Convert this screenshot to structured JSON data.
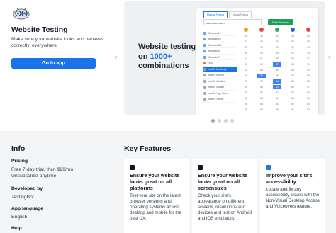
{
  "app": {
    "title": "Website Testing",
    "description": "Make sure your website looks and behaves correctly, everywhere",
    "go_button": "Go to app"
  },
  "carousel": {
    "headline_line1": "Website testing",
    "headline_on": "on ",
    "headline_count": "1000+",
    "headline_line3": "combinations",
    "prev_arrow": "‹",
    "next_arrow": "›",
    "active_slide": 1,
    "slide_count": 4,
    "mock": {
      "tabs": [
        "Manual Testing",
        "Visual Testing"
      ],
      "url": "www.ikea.com",
      "start_button": "Start Browser",
      "os_list": [
        "Windows 11",
        "Windows 10",
        "Windows 8.1",
        "Windows 8",
        "Windows 7",
        "Linux",
        "macOS Monterey",
        "macOS Big Sur",
        "macOS Catalina",
        "macOS Mojave",
        "macOS High Sierra",
        "macOS Sierra"
      ],
      "selected_os_index": 6,
      "browser_colors": [
        "#f59e0b",
        "#ea4335",
        "#34a853",
        "#2563eb",
        "#ef4444"
      ],
      "grid_rows": [
        [
          "98",
          "95",
          "95",
          "94",
          "96"
        ],
        [
          "97",
          "94",
          "90",
          "93",
          "95"
        ],
        [
          "96",
          "93",
          "91",
          "92",
          "94"
        ],
        [
          "95",
          "92",
          "89",
          "91",
          "93"
        ],
        [
          "94",
          "91",
          "88",
          "90",
          "92"
        ],
        [
          "93",
          "90",
          "87",
          "89",
          "91"
        ],
        [
          "92",
          "89",
          "86",
          "88",
          "90"
        ],
        [
          "91",
          "88",
          "85",
          "87",
          "89"
        ],
        [
          "90",
          "87",
          "84",
          "86",
          "88"
        ],
        [
          "89",
          "86",
          "83",
          "85",
          "87"
        ],
        [
          "88",
          "85",
          "82",
          "84",
          "86"
        ],
        [
          "87",
          "84",
          "81",
          "83",
          "85"
        ],
        [
          "86",
          "83",
          "80",
          "82",
          "84"
        ],
        [
          "85",
          "82",
          "79",
          "81",
          "83"
        ]
      ],
      "highlighted_cells": [
        "5-2",
        "7-1",
        "8-2",
        "9-2"
      ]
    }
  },
  "info": {
    "title": "Info",
    "pricing_label": "Pricing",
    "pricing_value_1": "Free 7-day trial, then $29/mo",
    "pricing_value_2": "Unsubscribe anytime",
    "developer_label": "Developed by",
    "developer_value": "TestingBot",
    "language_label": "App language",
    "language_value": "English",
    "help_label": "Help"
  },
  "features": {
    "title": "Key Features",
    "cards": [
      {
        "icon": "desktop-icon",
        "icon_color": "#111827",
        "title": "Ensure your website looks great on all platforms",
        "description": "Test your site on the latest browser versions and operating systems across desktop and mobile for the best UX."
      },
      {
        "icon": "devices-icon",
        "icon_color": "#111827",
        "title": "Ensure your website looks great on all screensizes",
        "description": "Check your site's appearance on different screens, resolutions and devices and test on Android and iOS emulators."
      },
      {
        "icon": "accessibility-icon",
        "icon_color": "#1a73e8",
        "title": "Improve your site's accessibility",
        "description": "Locate and fix any accessibility issues with the Non-Visual Desktop Access and Voiceovers feature."
      }
    ]
  },
  "colors": {
    "accent": "#1a73e8",
    "start_green": "#1e9e5b"
  }
}
